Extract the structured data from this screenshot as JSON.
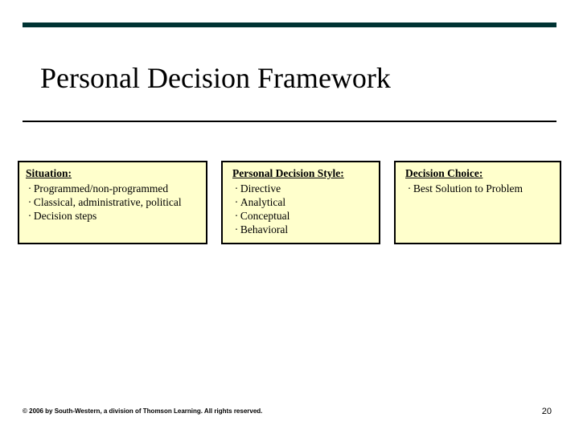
{
  "title": "Personal Decision Framework",
  "boxes": [
    {
      "heading": "Situation:",
      "items": [
        "Programmed/non-programmed",
        "Classical, administrative, political",
        "Decision steps"
      ]
    },
    {
      "heading": "Personal Decision Style:",
      "items": [
        "Directive",
        "Analytical",
        "Conceptual",
        "Behavioral"
      ]
    },
    {
      "heading": "Decision Choice:",
      "items": [
        "Best Solution to Problem"
      ]
    }
  ],
  "footer": "© 2006 by South-Western, a division of Thomson Learning. All rights reserved.",
  "page_number": "20"
}
